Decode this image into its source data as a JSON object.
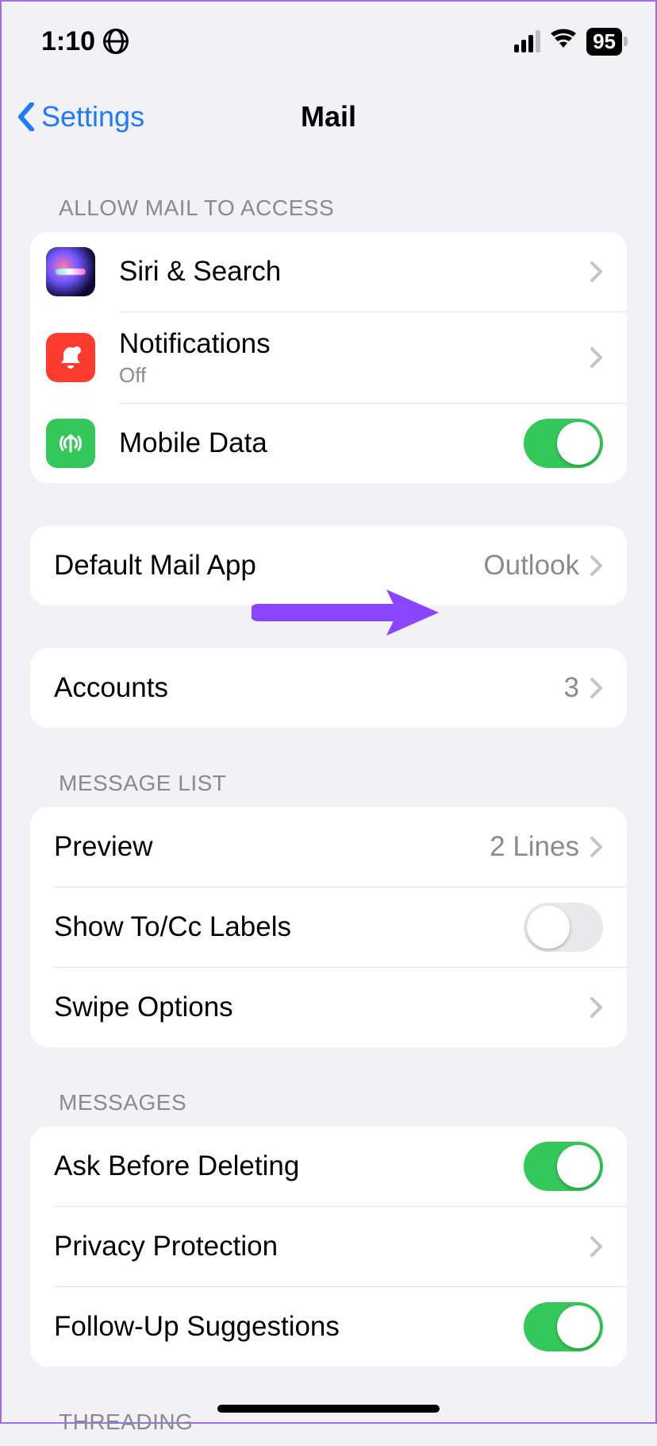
{
  "status_bar": {
    "time": "1:10",
    "battery_percent": "95"
  },
  "nav": {
    "back_label": "Settings",
    "title": "Mail"
  },
  "sections": {
    "access": {
      "header": "Allow Mail to Access",
      "siri": "Siri & Search",
      "notifications": {
        "label": "Notifications",
        "sub": "Off"
      },
      "mobile_data": {
        "label": "Mobile Data",
        "enabled": true
      }
    },
    "default_app": {
      "label": "Default Mail App",
      "value": "Outlook"
    },
    "accounts": {
      "label": "Accounts",
      "count": "3"
    },
    "message_list": {
      "header": "Message List",
      "preview": {
        "label": "Preview",
        "value": "2 Lines"
      },
      "show_tocc": {
        "label": "Show To/Cc Labels",
        "enabled": false
      },
      "swipe": "Swipe Options"
    },
    "messages": {
      "header": "Messages",
      "ask_delete": {
        "label": "Ask Before Deleting",
        "enabled": true
      },
      "privacy": "Privacy Protection",
      "follow_up": {
        "label": "Follow-Up Suggestions",
        "enabled": true
      }
    },
    "threading": {
      "header": "Threading"
    }
  },
  "annotation": {
    "arrow_color": "#8a46ff"
  }
}
